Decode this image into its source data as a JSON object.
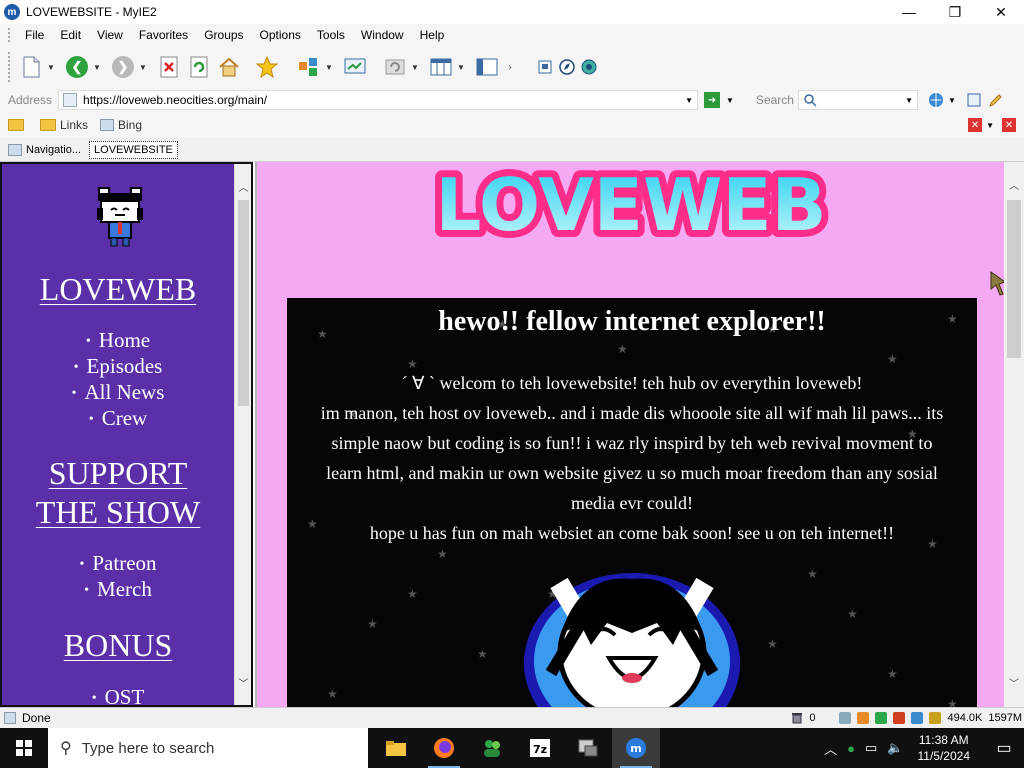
{
  "window": {
    "title": "LOVEWEBSITE - MyIE2"
  },
  "menu": [
    "File",
    "Edit",
    "View",
    "Favorites",
    "Groups",
    "Options",
    "Tools",
    "Window",
    "Help"
  ],
  "address": {
    "label": "Address",
    "url": "https://loveweb.neocities.org/main/",
    "search_label": "Search"
  },
  "links": {
    "folder1": "",
    "links_label": "Links",
    "bing_label": "Bing"
  },
  "tabs": [
    {
      "label": "Navigatio...",
      "active": false
    },
    {
      "label": "LOVEWEBSITE",
      "active": true
    }
  ],
  "sidebar": {
    "heading1": "LOVEWEB",
    "nav1": [
      "Home",
      "Episodes",
      "All News",
      "Crew"
    ],
    "heading2_line1": "SUPPORT",
    "heading2_line2": "THE SHOW",
    "nav2": [
      "Patreon",
      "Merch"
    ],
    "heading3": "BONUS",
    "nav3": [
      "OST"
    ]
  },
  "main": {
    "logo_text": "LOVEWEB",
    "title": "hewo!! fellow internet explorer!!",
    "lines": [
      "´ ∀ `   welcom to teh lovewebsite! teh hub ov everythin loveweb!",
      "im manon, teh host ov loveweb.. and i made dis whooole site all wif mah lil paws... its",
      "simple naow but coding is so fun!! i waz rly inspird by teh web revival movment to",
      "learn html, and makin ur own website givez u so much moar freedom than any sosial",
      "media evr could!",
      "hope u has fun on mah websiet an come bak soon! see u on teh internet!!"
    ]
  },
  "status": {
    "text": "Done",
    "count": "0",
    "size": "494.0K",
    "mem": "1597M"
  },
  "taskbar": {
    "search_placeholder": "Type here to search",
    "time": "11:38 AM",
    "date": "11/5/2024"
  },
  "colors": {
    "sidebar_bg": "#5a2fa8",
    "main_bg": "#f4a9f2",
    "logo_fill": "#3fe0f0",
    "logo_outline": "#ff2d8a"
  }
}
